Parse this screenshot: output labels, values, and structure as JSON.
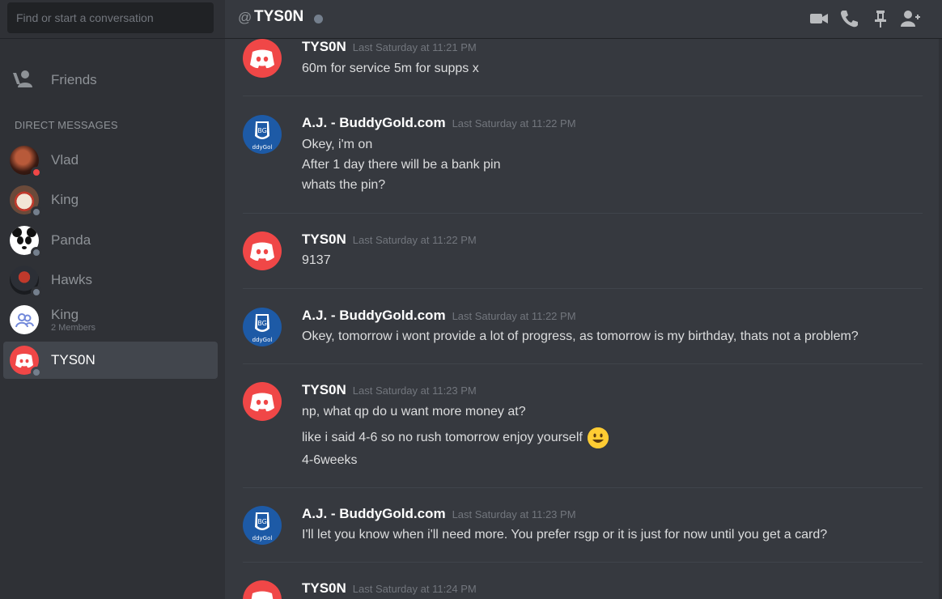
{
  "sidebar": {
    "search_placeholder": "Find or start a conversation",
    "friends_label": "Friends",
    "dm_header": "DIRECT MESSAGES",
    "dms": [
      {
        "name": "Vlad",
        "status": "dnd"
      },
      {
        "name": "King",
        "status": "offline"
      },
      {
        "name": "Panda",
        "status": "offline"
      },
      {
        "name": "Hawks",
        "status": "offline"
      },
      {
        "name": "King",
        "sub": "2 Members"
      },
      {
        "name": "TYS0N",
        "status": "offline",
        "active": true
      }
    ]
  },
  "header": {
    "at_symbol": "@",
    "title": "TYS0N",
    "icons": [
      "video-call-icon",
      "voice-call-icon",
      "pin-icon",
      "add-friend-icon"
    ]
  },
  "messages": [
    {
      "author": "TYS0N",
      "time": "Last Saturday at 11:21 PM",
      "lines": [
        "60m for service 5m for supps x"
      ]
    },
    {
      "author": "A.J. - BuddyGold.com",
      "time": "Last Saturday at 11:22 PM",
      "lines": [
        "Okey, i'm on",
        "After 1 day there will be a bank pin",
        "whats the pin?"
      ]
    },
    {
      "author": "TYS0N",
      "time": "Last Saturday at 11:22 PM",
      "lines": [
        "9137"
      ]
    },
    {
      "author": "A.J. - BuddyGold.com",
      "time": "Last Saturday at 11:22 PM",
      "lines": [
        "Okey, tomorrow i wont provide a lot of progress, as tomorrow is my birthday, thats not a problem?"
      ]
    },
    {
      "author": "TYS0N",
      "time": "Last Saturday at 11:23 PM",
      "lines": [
        "np, what qp do u want more money at?",
        "like i said 4-6 so no rush tomorrow enjoy yourself",
        "4-6weeks"
      ]
    },
    {
      "author": "A.J. - BuddyGold.com",
      "time": "Last Saturday at 11:23 PM",
      "lines": [
        "I'll let you know when i'll need more. You prefer rsgp or it is just for now until you get a card?"
      ]
    },
    {
      "author": "TYS0N",
      "time": "Last Saturday at 11:24 PM",
      "lines": []
    }
  ],
  "colors": {
    "discord_red": "#f04747",
    "buddygold_blue": "#1d5aa6"
  }
}
